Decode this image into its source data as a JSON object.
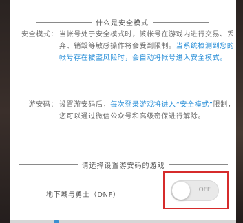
{
  "header": {
    "title": "什么是安全模式"
  },
  "safe_mode": {
    "label": "安全模式：",
    "text": "当帐号处于安全模式时，该帐号在游戏内进行交易、丢弃、销毁等敏感操作将会受到限制。",
    "highlight": "当系统检测到您的帐号存在被盗风险时，会自动将帐号进入安全模式。"
  },
  "game_password": {
    "label": "游安码：",
    "text_before": "设置游安码后，",
    "highlight": "每次登录游戏将进入“安全模式”",
    "text_after": "限制，您可以通过微信公众号和高级密保进行解除。"
  },
  "select_section": {
    "title": "请选择设置游安码的游戏"
  },
  "game": {
    "name": "地下城与勇士（DNF）",
    "toggle_label": "OFF",
    "toggle_on": false
  },
  "colors": {
    "accent": "#2a8fd8",
    "highlight_border": "#d62b2b"
  }
}
